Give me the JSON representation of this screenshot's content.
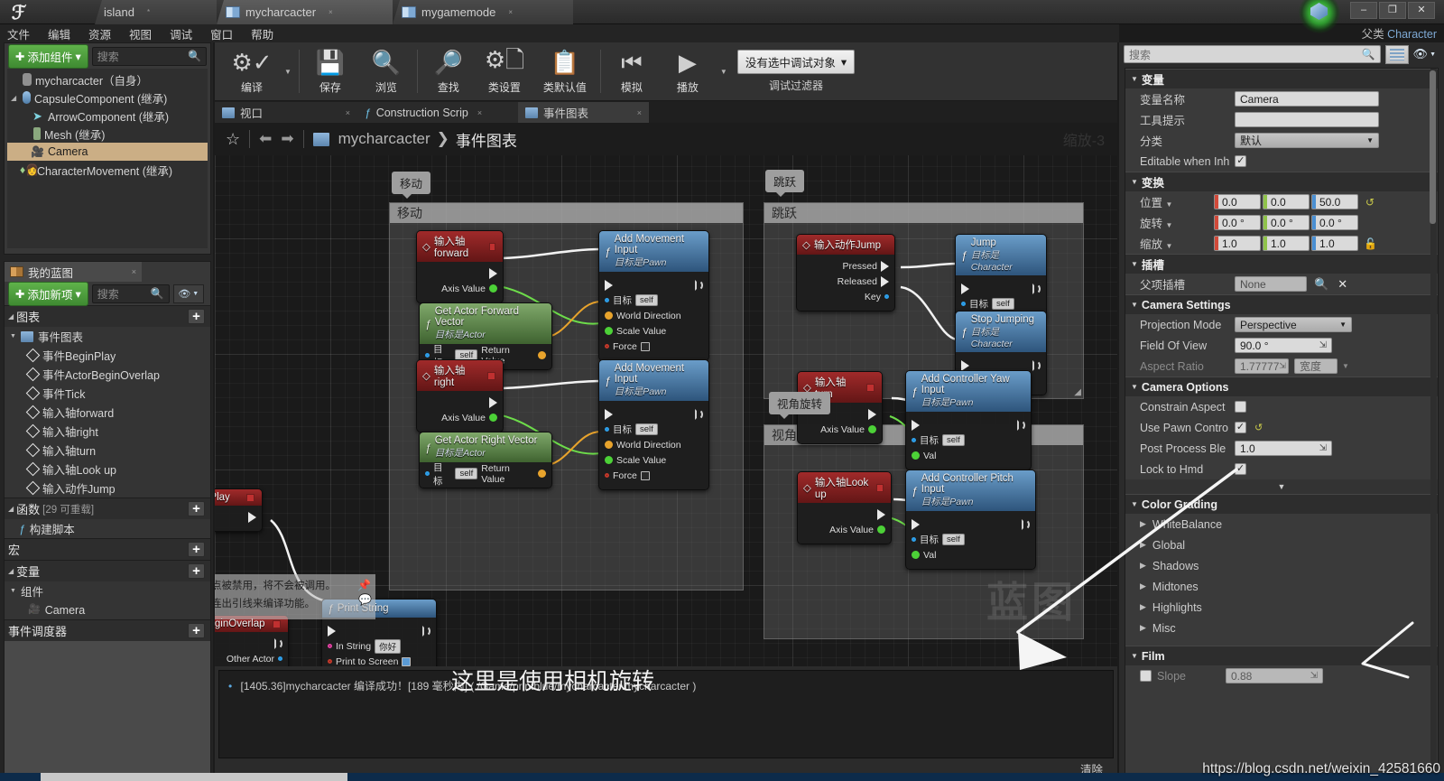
{
  "titlebar": {
    "logo": "ue-logo",
    "tabs": [
      {
        "label": "island",
        "icon": "level-icon",
        "active": false,
        "suffix": "*"
      },
      {
        "label": "mycharcacter",
        "icon": "blueprint-icon",
        "active": true,
        "close": "×"
      },
      {
        "label": "mygamemode",
        "icon": "blueprint-icon",
        "active": false,
        "close": "×"
      }
    ],
    "window_controls": {
      "minimize": "–",
      "maximize": "❐",
      "close": "✕"
    }
  },
  "menubar": {
    "items": [
      "文件",
      "编辑",
      "资源",
      "视图",
      "调试",
      "窗口",
      "帮助"
    ]
  },
  "parent_class": {
    "label": "父类",
    "value": "Character"
  },
  "components_panel": {
    "add_button": "添加组件",
    "add_caret": "▾",
    "search_placeholder": "搜索",
    "items": [
      {
        "label": "mycharcacter（自身）",
        "icon": "self-icon",
        "indent": 0,
        "selected": false,
        "expander": ""
      },
      {
        "label": "CapsuleComponent (继承)",
        "icon": "capsule-icon",
        "indent": 0,
        "selected": false,
        "expander": "◢"
      },
      {
        "label": "ArrowComponent (继承)",
        "icon": "arrow-icon",
        "indent": 1,
        "selected": false,
        "expander": ""
      },
      {
        "label": "Mesh (继承)",
        "icon": "mesh-icon",
        "indent": 1,
        "selected": false,
        "expander": ""
      },
      {
        "label": "Camera",
        "icon": "camera-icon",
        "indent": 1,
        "selected": true,
        "expander": ""
      },
      {
        "label": "CharacterMovement (继承)",
        "icon": "movement-icon",
        "indent": 0,
        "selected": false,
        "expander": "◇"
      }
    ]
  },
  "myblueprint_panel": {
    "tab_label": "我的蓝图",
    "tab_close": "×",
    "add_button": "添加新项",
    "add_caret": "▾",
    "search_placeholder": "搜索",
    "sections": [
      {
        "title": "图表",
        "plus": "+",
        "expander": "◢"
      },
      {
        "title": "函数",
        "note": "[29 可重载]",
        "plus": "+",
        "expander": "◢"
      },
      {
        "title": "宏",
        "plus": "+",
        "expander": ""
      },
      {
        "title": "变量",
        "plus": "+",
        "expander": "◢"
      },
      {
        "title": "事件调度器",
        "plus": "+",
        "expander": ""
      }
    ],
    "graph_root": "事件图表",
    "graph_events": [
      "事件BeginPlay",
      "事件ActorBeginOverlap",
      "事件Tick",
      "输入轴forward",
      "输入轴right",
      "输入轴turn",
      "输入轴Look up",
      "输入动作Jump"
    ],
    "functions": [
      "构建脚本"
    ],
    "variables_group": "组件",
    "variables": [
      "Camera"
    ]
  },
  "toolbar": {
    "buttons": [
      {
        "label": "编译",
        "icon": "compile-icon",
        "caret": true
      },
      {
        "label": "保存",
        "icon": "save-icon"
      },
      {
        "label": "浏览",
        "icon": "browse-icon"
      },
      {
        "label": "查找",
        "icon": "find-icon"
      },
      {
        "label": "类设置",
        "icon": "class-settings-icon"
      },
      {
        "label": "类默认值",
        "icon": "class-defaults-icon"
      },
      {
        "label": "模拟",
        "icon": "simulate-icon"
      },
      {
        "label": "播放",
        "icon": "play-icon",
        "caret": true
      }
    ],
    "debug_object": "没有选中调试对象",
    "debug_caret": "▾",
    "debug_filter_label": "调试过滤器"
  },
  "graph_tabs": [
    {
      "label": "视口",
      "icon": "viewport-icon",
      "active": false,
      "close": "×"
    },
    {
      "label": "Construction Scrip",
      "icon": "function-icon",
      "active": false,
      "close": "×"
    },
    {
      "label": "事件图表",
      "icon": "graph-icon",
      "active": true,
      "close": "×"
    }
  ],
  "graph_header": {
    "favorite_icon": "☆",
    "back_icon": "⬅",
    "forward_icon": "➡",
    "graph_icon": "graph-icon",
    "breadcrumb_root": "mycharcacter",
    "breadcrumb_sep": "❯",
    "breadcrumb_current": "事件图表",
    "zoom_label": "缩放-3"
  },
  "comments": [
    {
      "id": "move",
      "bubble": "移动",
      "title": "移动"
    },
    {
      "id": "jump",
      "bubble": "跳跃",
      "title": "跳跃"
    },
    {
      "id": "look",
      "bubble": "视角旋转",
      "title": "视角旋转"
    }
  ],
  "nodes": {
    "axis_forward": {
      "title": "输入轴forward",
      "pins": [
        "Axis Value"
      ]
    },
    "get_forward_vector": {
      "title": "Get Actor Forward Vector",
      "sub": "目标是Actor",
      "target": "目标",
      "self": "self",
      "ret": "Return Value"
    },
    "add_movement_input_1": {
      "title": "Add Movement Input",
      "sub": "目标是Pawn",
      "target": "目标",
      "self": "self",
      "pins": [
        "World Direction",
        "Scale Value",
        "Force"
      ]
    },
    "axis_right": {
      "title": "输入轴right",
      "pins": [
        "Axis Value"
      ]
    },
    "get_right_vector": {
      "title": "Get Actor Right Vector",
      "sub": "目标是Actor",
      "target": "目标",
      "self": "self",
      "ret": "Return Value"
    },
    "add_movement_input_2": {
      "title": "Add Movement Input",
      "sub": "目标是Pawn",
      "target": "目标",
      "self": "self",
      "pins": [
        "World Direction",
        "Scale Value",
        "Force"
      ]
    },
    "action_jump": {
      "title": "输入动作Jump",
      "pins": [
        "Pressed",
        "Released",
        "Key"
      ]
    },
    "jump_fn": {
      "title": "Jump",
      "sub": "目标是Character",
      "target": "目标",
      "self": "self"
    },
    "stop_jumping_fn": {
      "title": "Stop Jumping",
      "sub": "目标是Character",
      "target": "目标",
      "self": "self"
    },
    "axis_turn": {
      "title": "输入轴turn",
      "pins": [
        "Axis Value"
      ]
    },
    "yaw_input": {
      "title": "Add Controller Yaw Input",
      "sub": "目标是Pawn",
      "target": "目标",
      "self": "self",
      "val": "Val"
    },
    "axis_lookup": {
      "title": "输入轴Look up",
      "pins": [
        "Axis Value"
      ]
    },
    "pitch_input": {
      "title": "Add Controller Pitch Input",
      "sub": "目标是Pawn",
      "target": "目标",
      "self": "self",
      "val": "Val"
    },
    "begin_play": {
      "title": "BeginPlay"
    },
    "actor_begin_overlap": {
      "title": "ActorBeginOverlap",
      "pin": "Other Actor"
    },
    "print_string": {
      "title": "Print String",
      "in_string_label": "In String",
      "in_string_value": "你好",
      "print_to_screen": "Print to Screen"
    },
    "disabled_note": {
      "line1": "点被禁用，将不会被调用。",
      "line2": "连出引线来编译功能。"
    }
  },
  "watermark": "蓝图",
  "log": {
    "message": "[1405.36]mycharcacter 编译成功！[189 毫秒内] ( /Game/printblue/mycharcacter.mycharcacter )",
    "bullet": "•",
    "clear_button": "清除"
  },
  "annotation": "这里是使用相机旋转",
  "details_panel": {
    "search_placeholder": "搜索",
    "categories": [
      {
        "name": "变量",
        "rows": [
          {
            "label": "变量名称",
            "type": "text",
            "value": "Camera"
          },
          {
            "label": "工具提示",
            "type": "text",
            "value": ""
          },
          {
            "label": "分类",
            "type": "dropdown",
            "value": "默认"
          },
          {
            "label": "Editable when Inh",
            "type": "check",
            "checked": true
          }
        ]
      },
      {
        "name": "变换",
        "rows": [
          {
            "label": "位置",
            "type": "vector",
            "value": [
              "0.0",
              "0.0",
              "50.0"
            ],
            "reset": true
          },
          {
            "label": "旋转",
            "type": "vector",
            "value": [
              "0.0 °",
              "0.0 °",
              "0.0 °"
            ]
          },
          {
            "label": "缩放",
            "type": "vector",
            "value": [
              "1.0",
              "1.0",
              "1.0"
            ],
            "lock": true
          }
        ]
      },
      {
        "name": "插槽",
        "rows": [
          {
            "label": "父项插槽",
            "type": "text",
            "value": "None",
            "grey": true,
            "search": true,
            "clear": true
          }
        ]
      },
      {
        "name": "Camera Settings",
        "rows": [
          {
            "label": "Projection Mode",
            "type": "dropdown",
            "value": "Perspective"
          },
          {
            "label": "Field Of View",
            "type": "spin",
            "value": "90.0 °"
          },
          {
            "label": "Aspect Ratio",
            "type": "spin",
            "value": "1.77777",
            "dimmed": true,
            "extra": "宽度"
          }
        ]
      },
      {
        "name": "Camera Options",
        "rows": [
          {
            "label": "Constrain Aspect",
            "type": "check",
            "checked": false
          },
          {
            "label": "Use Pawn Contro",
            "type": "check",
            "checked": true,
            "reset": true
          },
          {
            "label": "Post Process Ble",
            "type": "spin",
            "value": "1.0"
          },
          {
            "label": "Lock to Hmd",
            "type": "check",
            "checked": true
          }
        ]
      },
      {
        "name": "Color Grading",
        "subrows": [
          "WhiteBalance",
          "Global",
          "Shadows",
          "Midtones",
          "Highlights",
          "Misc"
        ]
      },
      {
        "name": "Film",
        "rows": [
          {
            "label": "Slope",
            "type": "checkspin",
            "value": "0.88",
            "checked": false,
            "dimmed": true
          }
        ]
      }
    ]
  },
  "url_watermark": "https://blog.csdn.net/weixin_42581660",
  "colors": {
    "accent_green": "#4f9b3c",
    "selection": "#cbae85",
    "event_node": "#a02a2a",
    "function_node": "#6a9dc9",
    "pure_node": "#7fa86a",
    "exec_wire": "#ffffff",
    "float_wire": "#4cd137",
    "vector_wire": "#e8a32c"
  }
}
